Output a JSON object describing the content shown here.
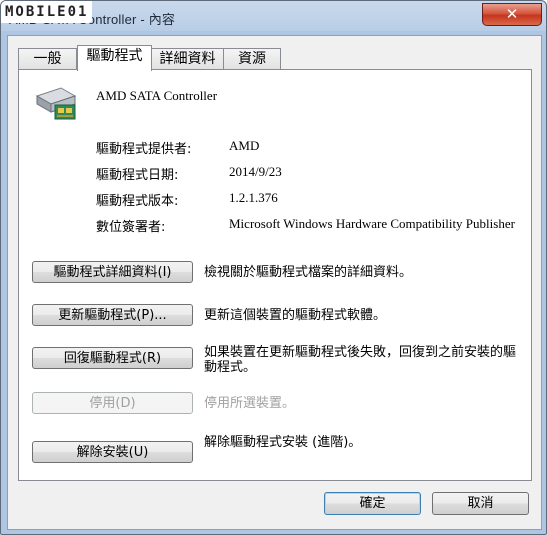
{
  "window": {
    "title": "AMD SATA Controller - 內容",
    "watermark": "MOBILE01",
    "close_label": "✕"
  },
  "tabs": [
    {
      "label": "一般"
    },
    {
      "label": "驅動程式"
    },
    {
      "label": "詳細資料"
    },
    {
      "label": "資源"
    }
  ],
  "device": {
    "name": "AMD SATA Controller",
    "icon": "sata-controller-icon"
  },
  "properties": [
    {
      "label": "驅動程式提供者:",
      "value": "AMD"
    },
    {
      "label": "驅動程式日期:",
      "value": "2014/9/23"
    },
    {
      "label": "驅動程式版本:",
      "value": "1.2.1.376"
    },
    {
      "label": "數位簽署者:",
      "value": "Microsoft Windows Hardware Compatibility Publisher"
    }
  ],
  "actions": [
    {
      "button": "驅動程式詳細資料(I)",
      "desc": "檢視關於驅動程式檔案的詳細資料。"
    },
    {
      "button": "更新驅動程式(P)...",
      "desc": "更新這個裝置的驅動程式軟體。"
    },
    {
      "button": "回復驅動程式(R)",
      "desc": "如果裝置在更新驅動程式後失敗，回復到之前安裝的驅動程式。"
    },
    {
      "button": "停用(D)",
      "desc": "停用所選裝置。"
    },
    {
      "button": "解除安裝(U)",
      "desc": "解除驅動程式安裝 (進階)。"
    }
  ],
  "footer": {
    "ok_label": "確定",
    "cancel_label": "取消"
  },
  "colors": {
    "titlebar": "#b8cde6",
    "close_button": "#c6341c",
    "panel_bg": "#ffffff",
    "dialog_bg": "#f0f0f0"
  }
}
